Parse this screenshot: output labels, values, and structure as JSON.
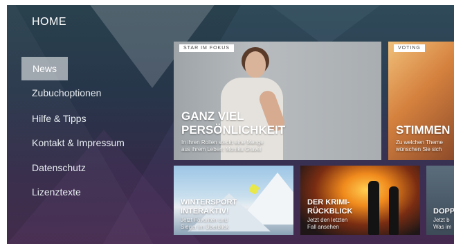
{
  "header": {
    "title": "HOME"
  },
  "menu": {
    "items": [
      {
        "label": "News",
        "active": true
      },
      {
        "label": "Zubuchoptionen",
        "active": false
      },
      {
        "label": "Hilfe & Tipps",
        "active": false
      },
      {
        "label": "Kontakt & Impressum",
        "active": false
      },
      {
        "label": "Datenschutz",
        "active": false
      },
      {
        "label": "Lizenztexte",
        "active": false
      }
    ]
  },
  "tiles": {
    "star": {
      "tag": "STAR IM FOKUS",
      "headline_1": "GANZ VIEL",
      "headline_2": "PERSÖNLICHKEIT",
      "sub_1": "In ihren Rollen steckt eine Menge",
      "sub_2": "aus ihrem Leben: Monika Gravel"
    },
    "voting": {
      "tag": "VOTING",
      "headline_1": "STIMMEN",
      "sub_1": "Zu welchen Theme",
      "sub_2": "wünschen Sie sich"
    },
    "winter": {
      "headline_1": "WINTERSPORT",
      "headline_2": "INTERAKTIV!",
      "sub_1": "Jetzt Favoriten und",
      "sub_2": "Sieger im Überblick"
    },
    "krimi": {
      "headline_1": "DER KRIMI-",
      "headline_2": "RÜCKBLICK",
      "sub_1": "Jetzt den letzten",
      "sub_2": "Fall ansehen"
    },
    "dopp": {
      "headline_1": "DOPP",
      "sub_1": "Jetzt b",
      "sub_2": "Was im"
    }
  },
  "colors": {
    "active_menu_bg": "#ffffff8c",
    "text": "#ffffff"
  }
}
